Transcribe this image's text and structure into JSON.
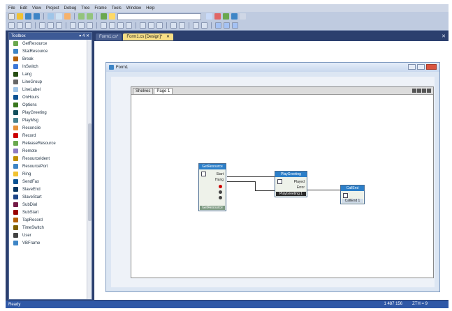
{
  "menu": [
    "File",
    "Edit",
    "View",
    "Project",
    "Debug",
    "Tree",
    "Frame",
    "Tools",
    "Window",
    "Help"
  ],
  "toolbar": {
    "combo_value": "",
    "button_colors": [
      "#e9e9e9",
      "#f1c232",
      "#3d85c6",
      "#3d85c6",
      "#9fc5e8",
      "#cfe2f3",
      "#f6b26b",
      "#93c47d",
      "#ffd966",
      "#c9daf8",
      "#e06666",
      "#6aa84f"
    ]
  },
  "toolbox": {
    "title": "Toolbox",
    "pin": "▾ 4 ✕",
    "items": [
      {
        "label": "GetResource",
        "color": "#6aa84f"
      },
      {
        "label": "StatResource",
        "color": "#3d85c6"
      },
      {
        "label": "Break",
        "color": "#b45f06"
      },
      {
        "label": "InSwitch",
        "color": "#3c78d8"
      },
      {
        "label": "Lang",
        "color": "#274e13"
      },
      {
        "label": "LineGroup",
        "color": "#666666"
      },
      {
        "label": "LineLabel",
        "color": "#9fc5e8"
      },
      {
        "label": "OnHours",
        "color": "#0b5394"
      },
      {
        "label": "Options",
        "color": "#38761d"
      },
      {
        "label": "PlayGreeting",
        "color": "#134f5c"
      },
      {
        "label": "PlayMsg",
        "color": "#45818e"
      },
      {
        "label": "Reconcile",
        "color": "#e69138"
      },
      {
        "label": "Record",
        "color": "#cc0000"
      },
      {
        "label": "ReleaseResource",
        "color": "#6aa84f"
      },
      {
        "label": "Remote",
        "color": "#8e7cc3"
      },
      {
        "label": "ResourceIdent",
        "color": "#bf9000"
      },
      {
        "label": "ResourcePort",
        "color": "#3d85c6"
      },
      {
        "label": "Ring",
        "color": "#f1c232"
      },
      {
        "label": "SendFax",
        "color": "#0b5394"
      },
      {
        "label": "SlaveEnd",
        "color": "#073763"
      },
      {
        "label": "SlaveStart",
        "color": "#1c4587"
      },
      {
        "label": "SubDial",
        "color": "#741b47"
      },
      {
        "label": "SubStart",
        "color": "#990000"
      },
      {
        "label": "TapRecord",
        "color": "#b45f06"
      },
      {
        "label": "TimeSwitch",
        "color": "#7f6000"
      },
      {
        "label": "User",
        "color": "#434343"
      },
      {
        "label": "VBFrame",
        "color": "#3d85c6"
      }
    ]
  },
  "tabs": [
    {
      "label": "Form1.cs*",
      "active": false
    },
    {
      "label": "Form1.cs [Design]*",
      "active": true
    }
  ],
  "form": {
    "title": "Form1"
  },
  "page_tabs": [
    "Shelves",
    "Page 1"
  ],
  "blocks": {
    "b1": {
      "title": "GetResource",
      "ports": [
        "Start",
        "Hang"
      ],
      "footer": "GetResource"
    },
    "b2": {
      "title": "PlayGreeting",
      "ports": [
        "Played",
        "Error"
      ],
      "footer": "PlayGreeting 1"
    },
    "b3": {
      "title": "CallEnd",
      "footer": "CallEnd 1"
    }
  },
  "status": {
    "left": "Ready",
    "ln": "1  487  156",
    "ch": "ZTH = 9"
  }
}
